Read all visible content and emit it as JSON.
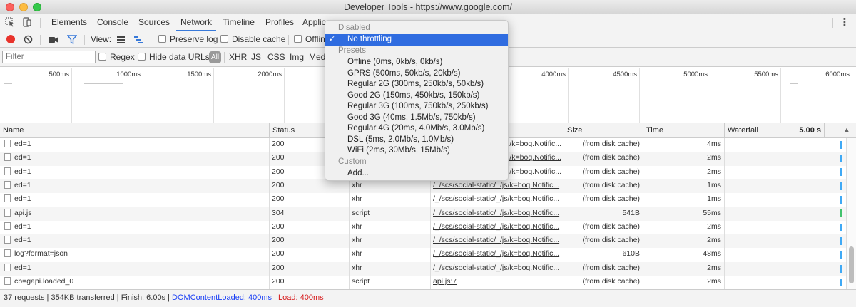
{
  "window": {
    "title": "Developer Tools - https://www.google.com/"
  },
  "tabs": [
    "Elements",
    "Console",
    "Sources",
    "Network",
    "Timeline",
    "Profiles",
    "Applic"
  ],
  "active_tab": "Network",
  "toolbar": {
    "view_label": "View:",
    "preserve_log": "Preserve log",
    "disable_cache": "Disable cache",
    "offline": "Offlin"
  },
  "filterbar": {
    "placeholder": "Filter",
    "regex": "Regex",
    "hide_data_urls": "Hide data URLs",
    "all": "All",
    "types": [
      "XHR",
      "JS",
      "CSS",
      "Img",
      "Med"
    ]
  },
  "overview": {
    "ticks": [
      "500ms",
      "1000ms",
      "1500ms",
      "2000ms",
      "4000ms",
      "4500ms",
      "5000ms",
      "5500ms",
      "6000ms"
    ]
  },
  "columns": {
    "name": "Name",
    "status": "Status",
    "size": "Size",
    "time": "Time",
    "waterfall": "Waterfall",
    "waterfall_value": "5.00 s"
  },
  "rows": [
    {
      "name": "ed=1",
      "status": "200",
      "type": "",
      "initiator": "_/js/k=boq.Notific...",
      "size": "(from disk cache)",
      "time": "4ms"
    },
    {
      "name": "ed=1",
      "status": "200",
      "type": "",
      "initiator": "_/js/k=boq.Notific...",
      "size": "(from disk cache)",
      "time": "2ms"
    },
    {
      "name": "ed=1",
      "status": "200",
      "type": "",
      "initiator": "_/js/k=boq.Notific...",
      "size": "(from disk cache)",
      "time": "2ms"
    },
    {
      "name": "ed=1",
      "status": "200",
      "type": "xhr",
      "initiator": "/_/scs/social-static/_/js/k=boq.Notific...",
      "size": "(from disk cache)",
      "time": "1ms"
    },
    {
      "name": "ed=1",
      "status": "200",
      "type": "xhr",
      "initiator": "/_/scs/social-static/_/js/k=boq.Notific...",
      "size": "(from disk cache)",
      "time": "1ms"
    },
    {
      "name": "api.js",
      "status": "304",
      "type": "script",
      "initiator": "/_/scs/social-static/_/js/k=boq.Notific...",
      "size": "541B",
      "time": "55ms"
    },
    {
      "name": "ed=1",
      "status": "200",
      "type": "xhr",
      "initiator": "/_/scs/social-static/_/js/k=boq.Notific...",
      "size": "(from disk cache)",
      "time": "2ms"
    },
    {
      "name": "ed=1",
      "status": "200",
      "type": "xhr",
      "initiator": "/_/scs/social-static/_/js/k=boq.Notific...",
      "size": "(from disk cache)",
      "time": "2ms"
    },
    {
      "name": "log?format=json",
      "status": "200",
      "type": "xhr",
      "initiator": "/_/scs/social-static/_/js/k=boq.Notific...",
      "size": "610B",
      "time": "48ms"
    },
    {
      "name": "ed=1",
      "status": "200",
      "type": "xhr",
      "initiator": "/_/scs/social-static/_/js/k=boq.Notific...",
      "size": "(from disk cache)",
      "time": "2ms"
    },
    {
      "name": "cb=gapi.loaded_0",
      "status": "200",
      "type": "script",
      "initiator": "api.js:7",
      "size": "(from disk cache)",
      "time": "2ms"
    }
  ],
  "status_bar": {
    "summary": "37 requests | 354KB transferred | Finish: 6.00s | ",
    "dom": "DOMContentLoaded: 400ms",
    "sep": " | ",
    "load": "Load: 400ms"
  },
  "throttle_menu": {
    "disabled_header": "Disabled",
    "selected": "No throttling",
    "presets_header": "Presets",
    "presets": [
      "Offline (0ms, 0kb/s, 0kb/s)",
      "GPRS (500ms, 50kb/s, 20kb/s)",
      "Regular 2G (300ms, 250kb/s, 50kb/s)",
      "Good 2G (150ms, 450kb/s, 150kb/s)",
      "Regular 3G (100ms, 750kb/s, 250kb/s)",
      "Good 3G (40ms, 1.5Mb/s, 750kb/s)",
      "Regular 4G (20ms, 4.0Mb/s, 3.0Mb/s)",
      "DSL (5ms, 2.0Mb/s, 1.0Mb/s)",
      "WiFi (2ms, 30Mb/s, 15Mb/s)"
    ],
    "custom_header": "Custom",
    "add": "Add..."
  }
}
